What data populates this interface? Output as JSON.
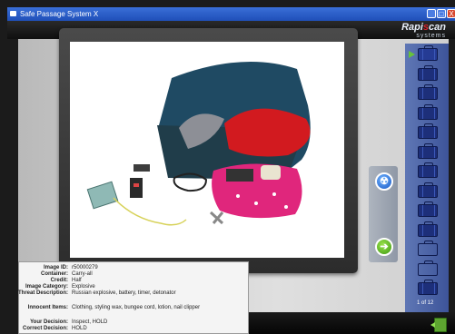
{
  "window": {
    "title": "Safe Passage System X",
    "minimize": "_",
    "maximize": "□",
    "close": "X"
  },
  "brand": {
    "name_part1": "Rapi",
    "name_accent": "s",
    "name_part2": "can",
    "subtitle": "systems"
  },
  "controls": {
    "radiation_glyph": "☢",
    "next_glyph": "➔"
  },
  "queue": {
    "counter": "1 of 12",
    "bags": [
      {
        "state": "active"
      },
      {
        "state": "filled"
      },
      {
        "state": "filled"
      },
      {
        "state": "filled"
      },
      {
        "state": "filled"
      },
      {
        "state": "filled"
      },
      {
        "state": "filled"
      },
      {
        "state": "filled"
      },
      {
        "state": "filled"
      },
      {
        "state": "filled"
      },
      {
        "state": "empty"
      },
      {
        "state": "empty"
      },
      {
        "state": "filled"
      }
    ]
  },
  "details": {
    "image_id_label": "Image ID:",
    "image_id": "r50000279",
    "container_label": "Container:",
    "container": "Carry-all",
    "credit_label": "Credit:",
    "credit": "Half",
    "category_label": "Image Category:",
    "category": "Explosive",
    "threat_label": "Threat Description:",
    "threat": "Russian explosive, battery, timer, detonator",
    "innocent_label": "Innocent Items:",
    "innocent": "Clothing, styling wax, bungee cord, lotion, nail clipper",
    "your_decision_label": "Your Decision:",
    "your_decision": "Inspect, HOLD",
    "correct_decision_label": "Correct Decision:",
    "correct_decision": "HOLD"
  },
  "colors": {
    "titlebar": "#1f4fb8",
    "brand_accent": "#d7252c",
    "next_button": "#3d9a12",
    "radiation_button": "#1a58c4",
    "side_panel": "#4a63a8"
  }
}
